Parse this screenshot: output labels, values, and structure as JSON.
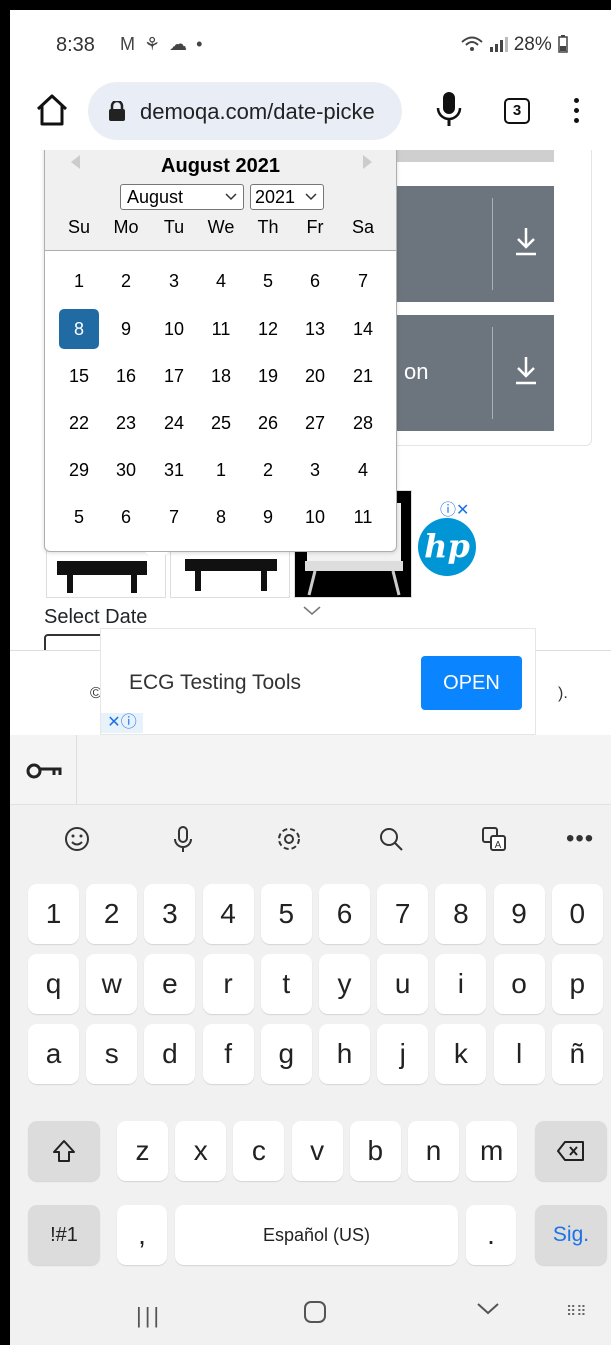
{
  "status_bar": {
    "time": "8:38",
    "notif_icons": "M ⚘ ☁ •",
    "right": "28%"
  },
  "browser": {
    "url": "demoqa.com/date-picke",
    "tab_count": "3"
  },
  "page": {
    "select_date_label": "Select Date",
    "download_btn_2_text": "on",
    "footer_left": "©",
    "footer_right": ").",
    "adchoices": "ⓘ✕"
  },
  "calendar": {
    "title": "August 2021",
    "month_select": "August",
    "year_select": "2021",
    "weekdays": [
      "Su",
      "Mo",
      "Tu",
      "We",
      "Th",
      "Fr",
      "Sa"
    ],
    "weeks": [
      [
        "1",
        "2",
        "3",
        "4",
        "5",
        "6",
        "7"
      ],
      [
        "8",
        "9",
        "10",
        "11",
        "12",
        "13",
        "14"
      ],
      [
        "15",
        "16",
        "17",
        "18",
        "19",
        "20",
        "21"
      ],
      [
        "22",
        "23",
        "24",
        "25",
        "26",
        "27",
        "28"
      ],
      [
        "29",
        "30",
        "31",
        "1",
        "2",
        "3",
        "4"
      ],
      [
        "5",
        "6",
        "7",
        "8",
        "9",
        "10",
        "11"
      ]
    ],
    "selected_day": "8",
    "selected_color": "#216ba5"
  },
  "ad_banner": {
    "title": "ECG Testing Tools",
    "cta": "OPEN",
    "ad_marker": "✕ⓘ"
  },
  "keyboard": {
    "row_numbers": [
      "1",
      "2",
      "3",
      "4",
      "5",
      "6",
      "7",
      "8",
      "9",
      "0"
    ],
    "row_1": [
      "q",
      "w",
      "e",
      "r",
      "t",
      "y",
      "u",
      "i",
      "o",
      "p"
    ],
    "row_2": [
      "a",
      "s",
      "d",
      "f",
      "g",
      "h",
      "j",
      "k",
      "l",
      "ñ"
    ],
    "row_3": [
      "z",
      "x",
      "c",
      "v",
      "b",
      "n",
      "m"
    ],
    "symbols_key": "!#1",
    "comma_key": ",",
    "space_label": "Español (US)",
    "period_key": ".",
    "action_key": "Sig.",
    "toolbar_more": "•••"
  },
  "nav_bar": {
    "recent": "|||",
    "keyboard_switch": "⠿⠿"
  }
}
